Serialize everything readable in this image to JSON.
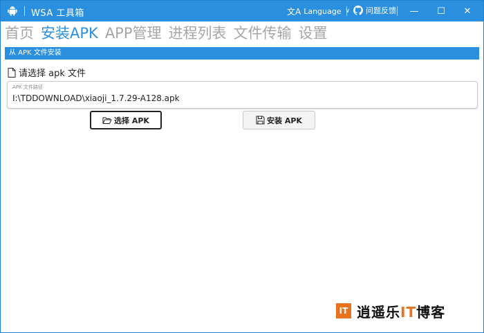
{
  "window": {
    "title": "WSA 工具箱",
    "language_label": "Language",
    "feedback_label": "问题反馈",
    "minimize_glyph": "—",
    "maximize_glyph": "☐",
    "close_glyph": "✕"
  },
  "nav": {
    "tabs": [
      {
        "label": "首页",
        "active": false
      },
      {
        "label": "安装APK",
        "active": true
      },
      {
        "label": "APP管理",
        "active": false
      },
      {
        "label": "进程列表",
        "active": false
      },
      {
        "label": "文件传输",
        "active": false
      },
      {
        "label": "设置",
        "active": false
      }
    ]
  },
  "install": {
    "section_title": "从 APK 文件安装",
    "choose_label": "请选择 apk 文件",
    "path_field_label": "APK 文件路径",
    "path_value": "I:\\TDDOWNLOAD\\xiaoji_1.7.29-A128.apk",
    "select_button": "选择 APK",
    "install_button": "安装 APK"
  },
  "watermark": {
    "logo_text": "IT",
    "text_part1": "逍遥乐",
    "text_part2": "IT",
    "text_part3": "博客"
  },
  "colors": {
    "accent": "#2b8fe0",
    "inactive_tab": "#a6a6a6",
    "watermark_orange": "#e8721d"
  },
  "icons": {
    "app": "android-icon",
    "language": "translate-icon",
    "feedback": "github-icon",
    "file": "file-icon",
    "folder": "folder-open-icon",
    "save": "save-icon"
  }
}
